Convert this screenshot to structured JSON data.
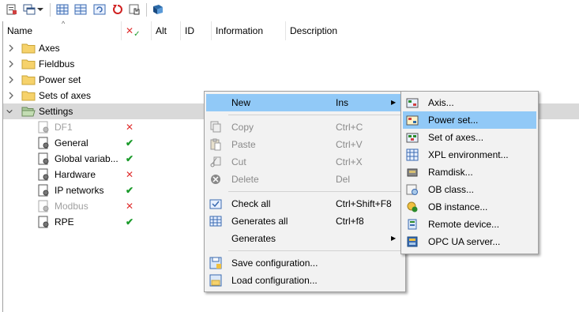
{
  "toolbar": {
    "buttons": [
      {
        "name": "project-icon"
      },
      {
        "name": "windows-icon"
      },
      {
        "name": "dropdown-arrow-icon"
      },
      {
        "name": "grid-icon"
      },
      {
        "name": "grid-alt-icon"
      },
      {
        "name": "refresh-icon"
      },
      {
        "name": "undo-icon"
      },
      {
        "name": "hand-icon"
      },
      {
        "name": "book-icon"
      }
    ]
  },
  "tree": {
    "columns": {
      "name": "Name",
      "check": "✗✓",
      "alt": "Alt",
      "id": "ID",
      "information": "Information",
      "description": "Description"
    },
    "items": [
      {
        "label": "Axes"
      },
      {
        "label": "Fieldbus"
      },
      {
        "label": "Power set"
      },
      {
        "label": "Sets of axes"
      },
      {
        "label": "Settings"
      }
    ],
    "children": [
      {
        "label": "DF1",
        "status": "✕"
      },
      {
        "label": "General",
        "status": "✔"
      },
      {
        "label": "Global variab...",
        "status": "✔"
      },
      {
        "label": "Hardware",
        "status": "✕"
      },
      {
        "label": "IP networks",
        "status": "✔"
      },
      {
        "label": "Modbus",
        "status": "✕"
      },
      {
        "label": "RPE",
        "status": "✔"
      }
    ]
  },
  "context_menu": {
    "items": [
      {
        "label": "New",
        "shortcut": "Ins"
      },
      {
        "label": "Copy",
        "shortcut": "Ctrl+C"
      },
      {
        "label": "Paste",
        "shortcut": "Ctrl+V"
      },
      {
        "label": "Cut",
        "shortcut": "Ctrl+X"
      },
      {
        "label": "Delete",
        "shortcut": "Del"
      },
      {
        "label": "Check all",
        "shortcut": "Ctrl+Shift+F8"
      },
      {
        "label": "Generates all",
        "shortcut": "Ctrl+f8"
      },
      {
        "label": "Generates",
        "shortcut": ""
      },
      {
        "label": "Save configuration...",
        "shortcut": ""
      },
      {
        "label": "Load configuration...",
        "shortcut": ""
      }
    ]
  },
  "submenu": {
    "items": [
      {
        "label": "Axis..."
      },
      {
        "label": "Power set..."
      },
      {
        "label": "Set of axes..."
      },
      {
        "label": "XPL environment..."
      },
      {
        "label": "Ramdisk..."
      },
      {
        "label": "OB class..."
      },
      {
        "label": "OB instance..."
      },
      {
        "label": "Remote device..."
      },
      {
        "label": "OPC UA server..."
      }
    ]
  },
  "colors": {
    "highlight": "#91c9f7",
    "selected_row": "#d9d9d9",
    "error_mark": "#e03030",
    "ok_mark": "#1a9a2a"
  }
}
